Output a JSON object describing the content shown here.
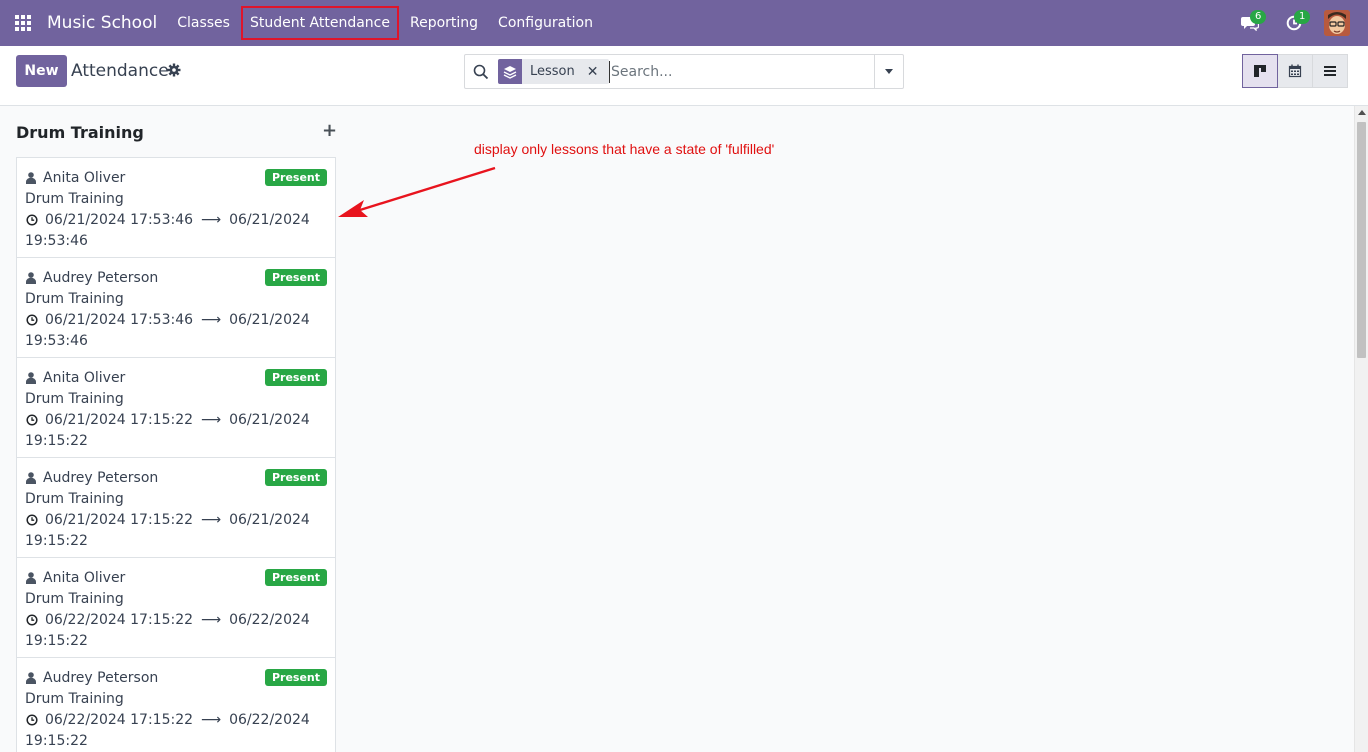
{
  "navbar": {
    "app_name": "Music School",
    "menu": [
      {
        "label": "Classes"
      },
      {
        "label": "Student Attendance"
      },
      {
        "label": "Reporting"
      },
      {
        "label": "Configuration"
      }
    ],
    "messages_count": "6",
    "activities_count": "1"
  },
  "control": {
    "new_label": "New",
    "title": "Attendance",
    "facet_label": "Lesson",
    "search_placeholder": "Search..."
  },
  "kanban": {
    "column_title": "Drum Training",
    "cards": [
      {
        "student": "Anita Oliver",
        "lesson": "Drum Training",
        "start": "06/21/2024 17:53:46",
        "end_date": "06/21/2024",
        "end_time": "19:53:46",
        "status": "Present"
      },
      {
        "student": "Audrey Peterson",
        "lesson": "Drum Training",
        "start": "06/21/2024 17:53:46",
        "end_date": "06/21/2024",
        "end_time": "19:53:46",
        "status": "Present"
      },
      {
        "student": "Anita Oliver",
        "lesson": "Drum Training",
        "start": "06/21/2024 17:15:22",
        "end_date": "06/21/2024",
        "end_time": "19:15:22",
        "status": "Present"
      },
      {
        "student": "Audrey Peterson",
        "lesson": "Drum Training",
        "start": "06/21/2024 17:15:22",
        "end_date": "06/21/2024",
        "end_time": "19:15:22",
        "status": "Present"
      },
      {
        "student": "Anita Oliver",
        "lesson": "Drum Training",
        "start": "06/22/2024 17:15:22",
        "end_date": "06/22/2024",
        "end_time": "19:15:22",
        "status": "Present"
      },
      {
        "student": "Audrey Peterson",
        "lesson": "Drum Training",
        "start": "06/22/2024 17:15:22",
        "end_date": "06/22/2024",
        "end_time": "19:15:22",
        "status": "Present"
      }
    ]
  },
  "annotation": {
    "text": "display only lessons that have a state of 'fulfilled'"
  },
  "colors": {
    "brand": "#71639e",
    "success": "#28a745",
    "annotation": "#e01010"
  }
}
